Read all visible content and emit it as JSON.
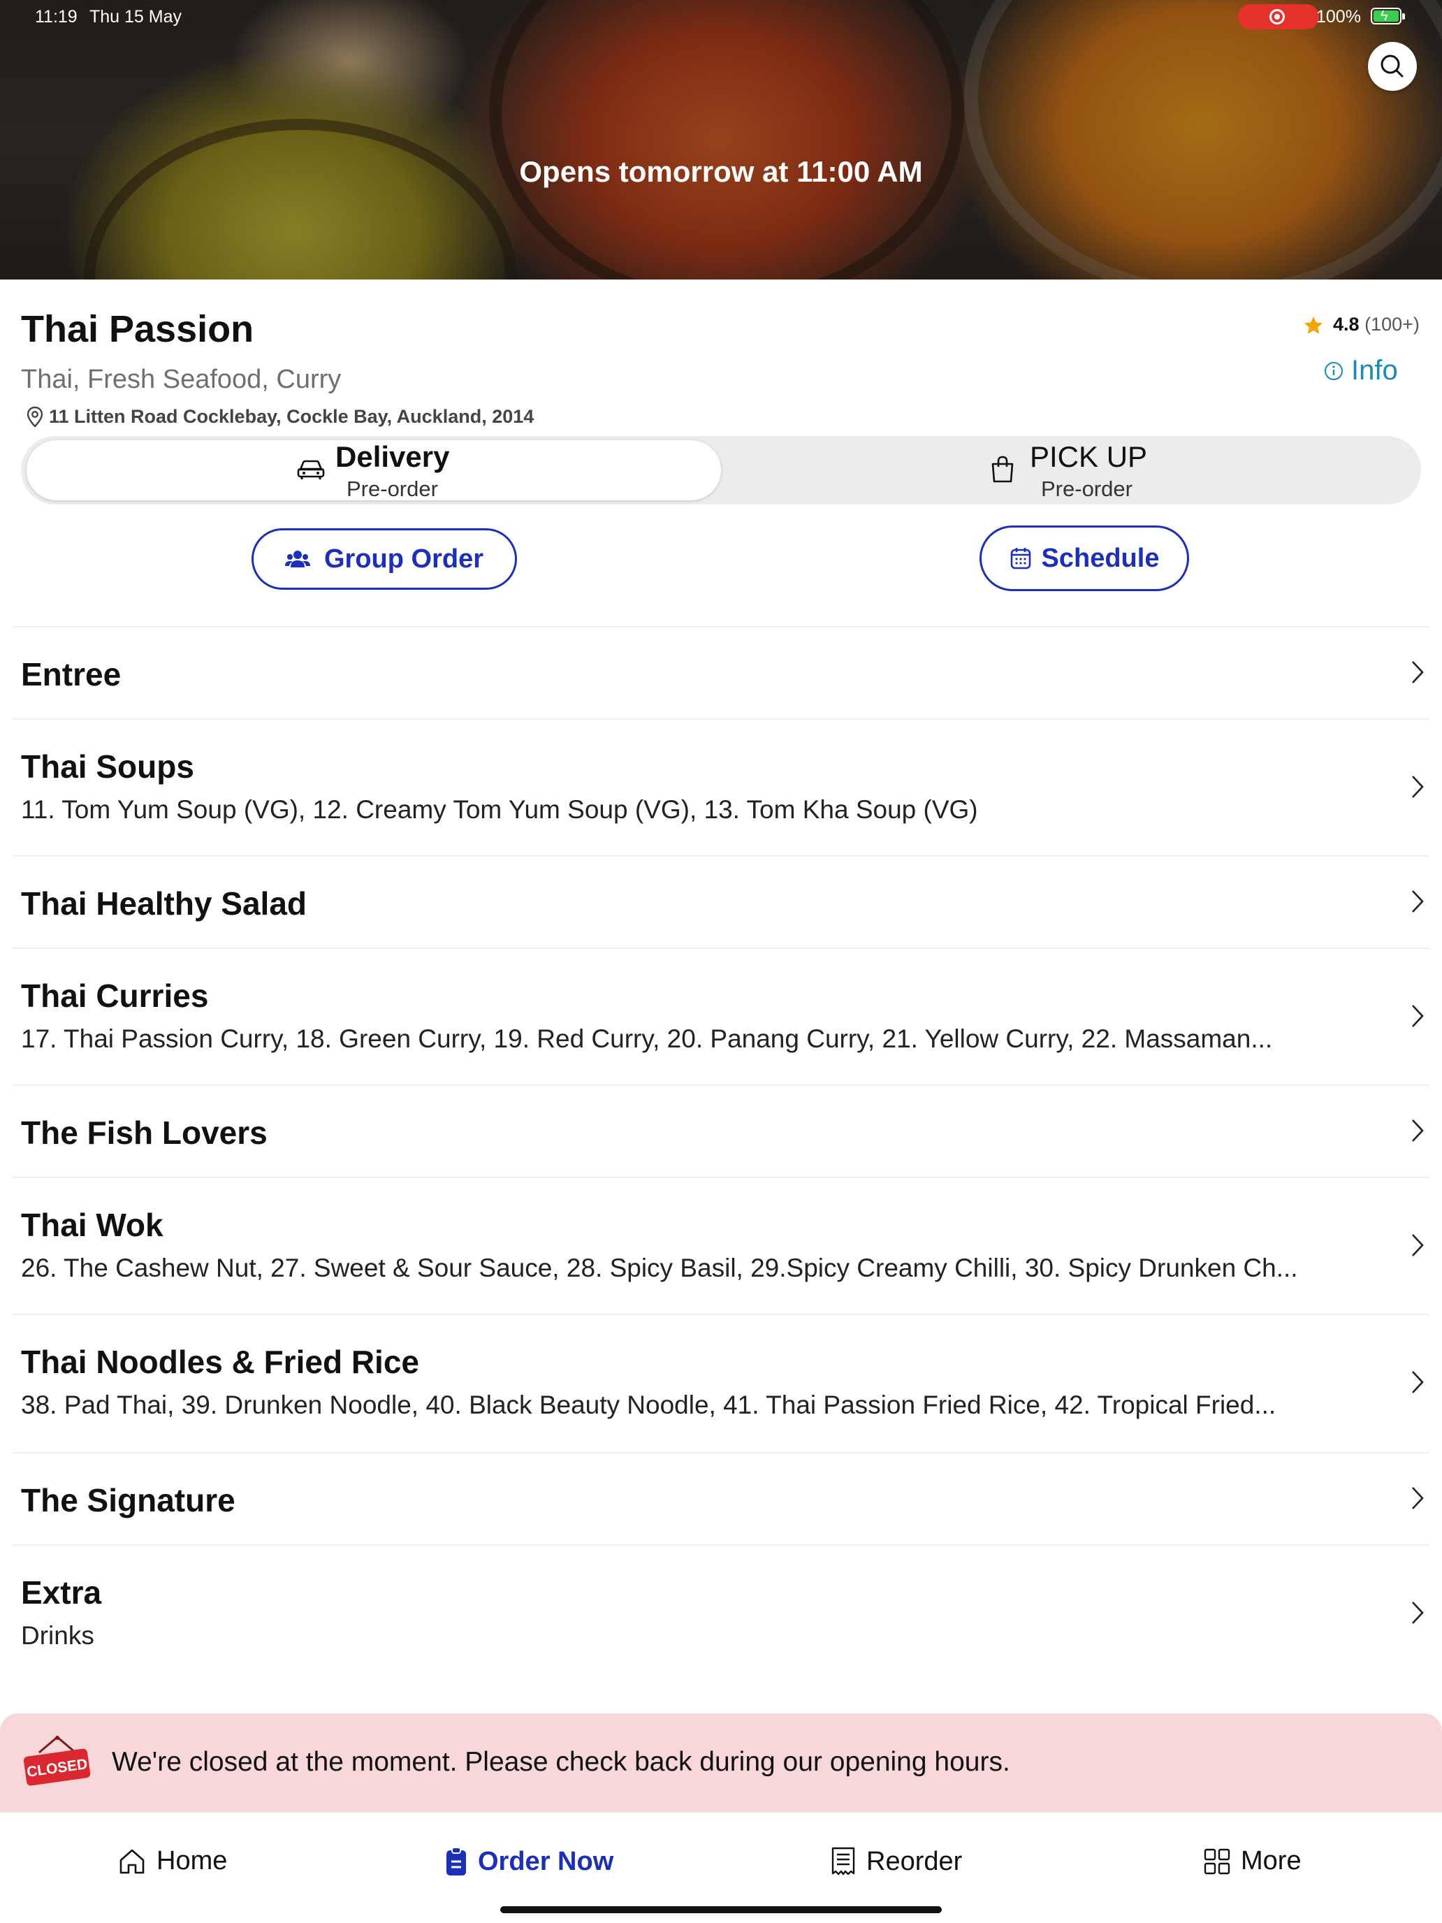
{
  "status_bar": {
    "time": "11:19",
    "date": "Thu 15 May",
    "battery": "100%"
  },
  "hero": {
    "title": "Opens tomorrow at 11:00 AM"
  },
  "restaurant": {
    "name": "Thai Passion",
    "cuisine": "Thai, Fresh Seafood, Curry",
    "address": "11 Litten Road Cocklebay, Cockle Bay, Auckland, 2014",
    "rating": "4.8",
    "rating_count": "(100+)",
    "info_label": "Info"
  },
  "order_mode": {
    "delivery_label": "Delivery",
    "delivery_sub": "Pre-order",
    "pickup_label": "PICK UP",
    "pickup_sub": "Pre-order",
    "selected": "delivery"
  },
  "actions": {
    "group_order": "Group Order",
    "schedule": "Schedule"
  },
  "menu": [
    {
      "title": "Entree",
      "desc": ""
    },
    {
      "title": "Thai Soups",
      "desc": "11. Tom Yum Soup (VG), 12. Creamy Tom Yum Soup (VG), 13. Tom Kha Soup (VG)"
    },
    {
      "title": "Thai Healthy Salad",
      "desc": ""
    },
    {
      "title": "Thai Curries",
      "desc": "17. Thai Passion Curry, 18. Green Curry, 19. Red Curry, 20. Panang Curry, 21. Yellow Curry, 22. Massaman..."
    },
    {
      "title": "The Fish Lovers",
      "desc": ""
    },
    {
      "title": "Thai Wok",
      "desc": "26. The Cashew Nut, 27. Sweet & Sour Sauce, 28. Spicy Basil, 29.Spicy Creamy Chilli, 30. Spicy Drunken Ch..."
    },
    {
      "title": "Thai Noodles & Fried Rice",
      "desc": "38. Pad Thai, 39. Drunken Noodle, 40. Black Beauty Noodle, 41. Thai Passion Fried Rice, 42. Tropical Fried..."
    },
    {
      "title": "The Signature",
      "desc": ""
    },
    {
      "title": "Extra",
      "desc": "Drinks"
    }
  ],
  "closed_banner": {
    "badge": "CLOSED",
    "message": "We're closed at the moment. Please check back during our opening hours."
  },
  "tab_bar": {
    "home": "Home",
    "order_now": "Order Now",
    "reorder": "Reorder",
    "more": "More",
    "active": "order_now"
  },
  "colors": {
    "accent_blue": "#1b2fb8",
    "info_blue": "#1a8ab8",
    "star": "#f5a300",
    "closed_banner_bg": "#f8d7da",
    "closed_red": "#d9282f"
  }
}
